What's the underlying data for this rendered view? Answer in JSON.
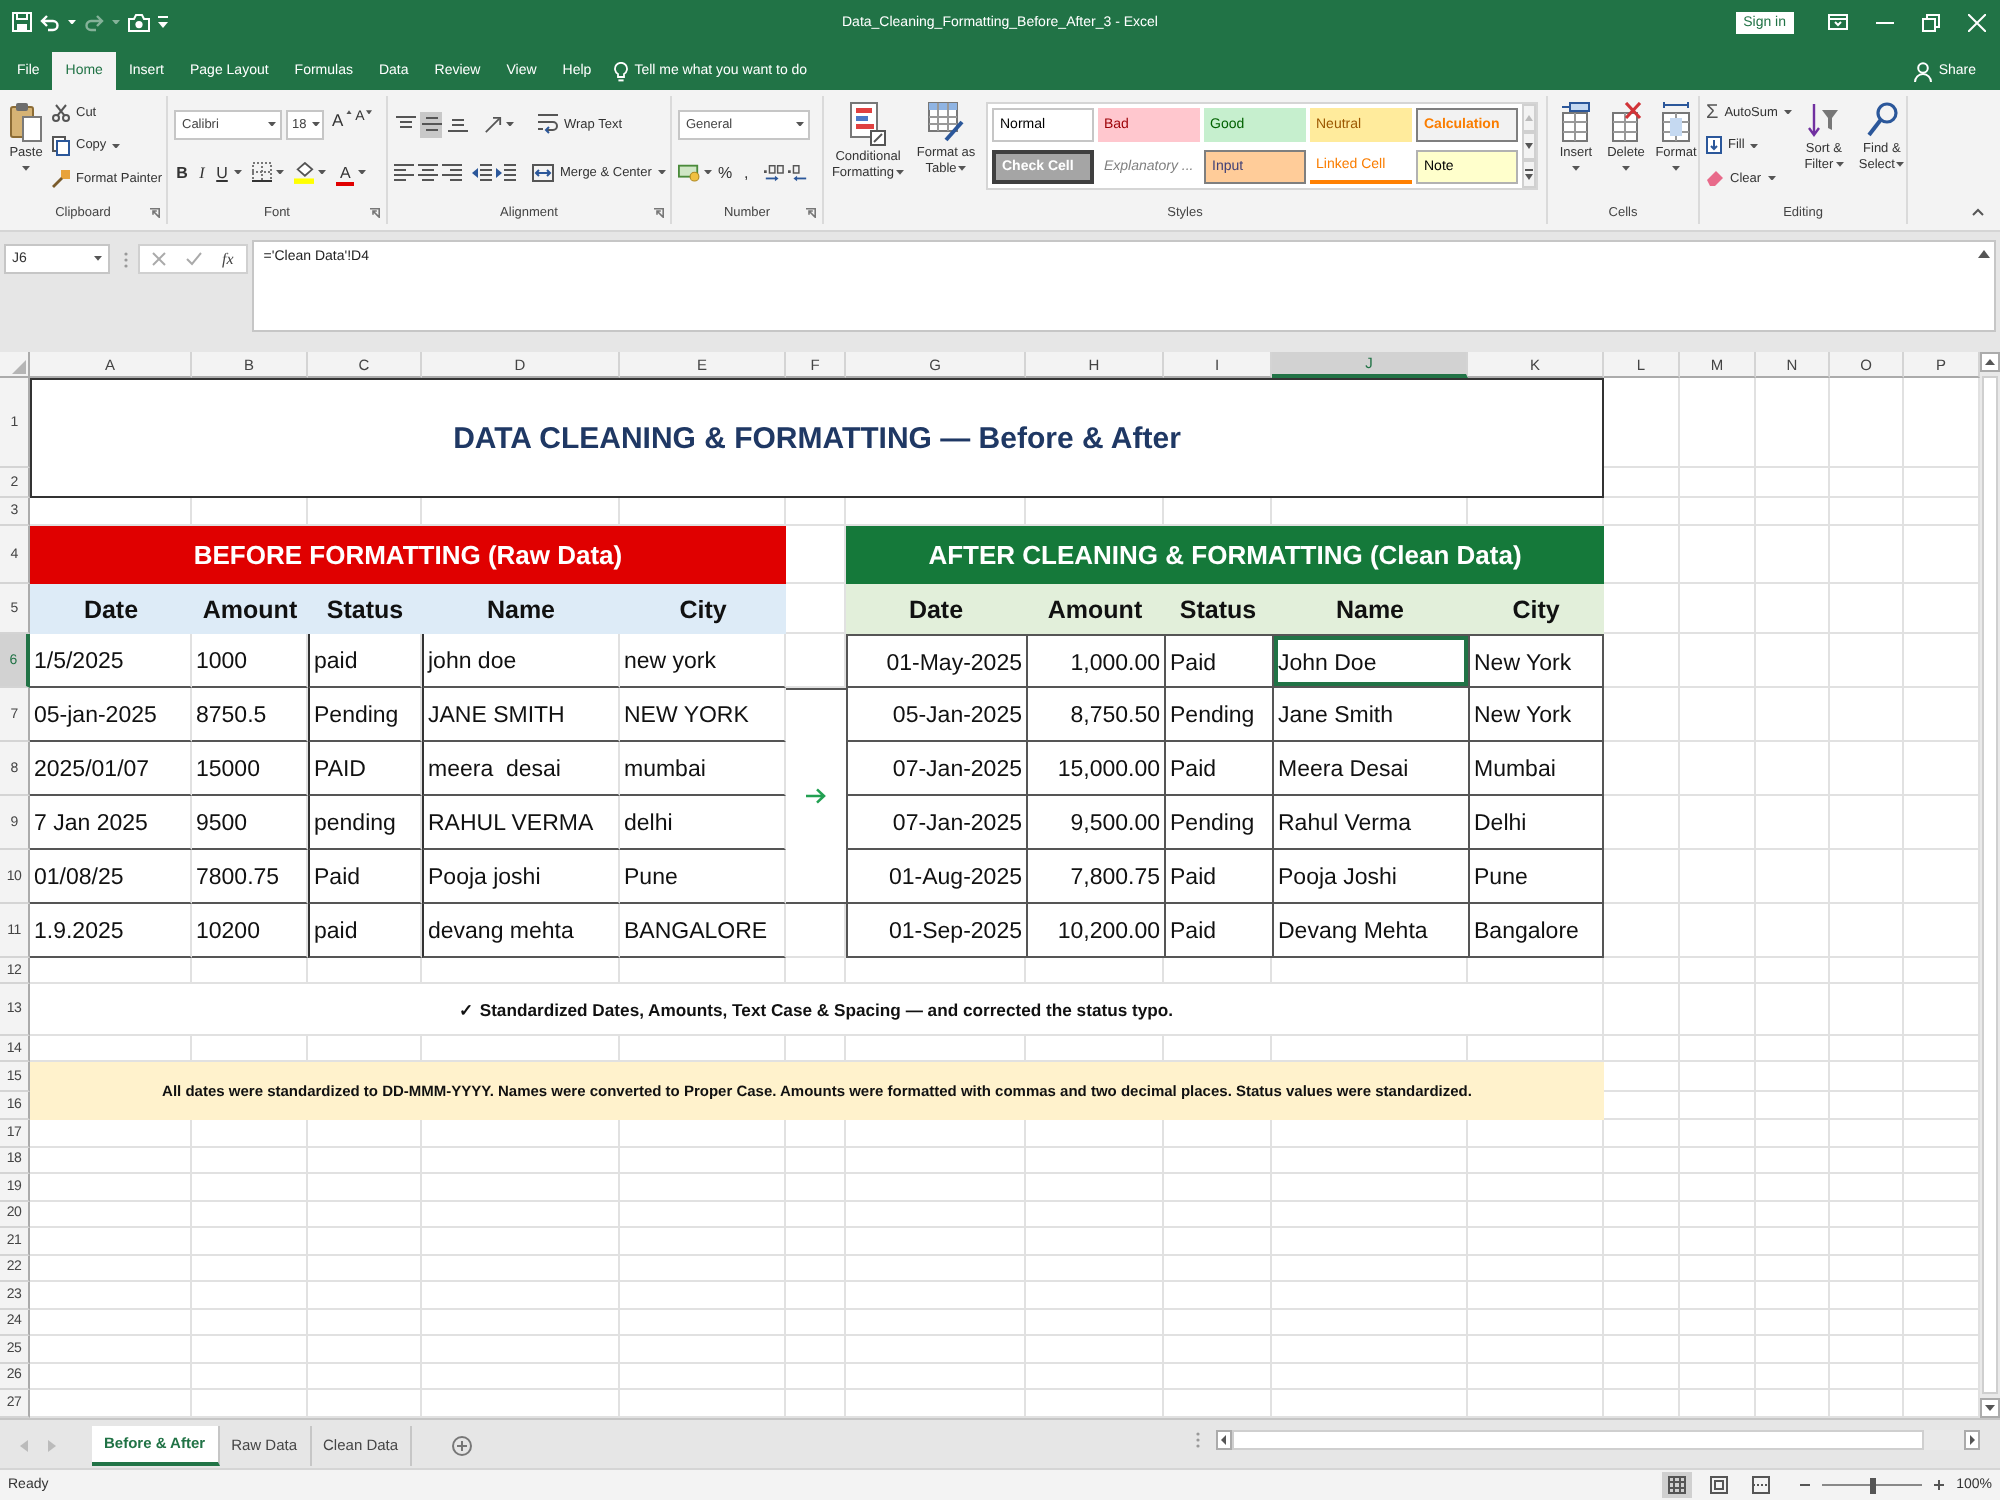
{
  "window": {
    "title": "Data_Cleaning_Formatting_Before_After_3 - Excel",
    "sign_in": "Sign in",
    "redo_disabled": true
  },
  "ribbon_tabs": [
    {
      "label": "File",
      "selected": false
    },
    {
      "label": "Home",
      "selected": true
    },
    {
      "label": "Insert",
      "selected": false
    },
    {
      "label": "Page Layout",
      "selected": false
    },
    {
      "label": "Formulas",
      "selected": false
    },
    {
      "label": "Data",
      "selected": false
    },
    {
      "label": "Review",
      "selected": false
    },
    {
      "label": "View",
      "selected": false
    },
    {
      "label": "Help",
      "selected": false
    }
  ],
  "tell_me": "Tell me what you want to do",
  "share": "Share",
  "ribbon": {
    "clipboard": {
      "label": "Clipboard",
      "paste": "Paste",
      "cut": "Cut",
      "copy": "Copy",
      "format_painter": "Format Painter"
    },
    "font": {
      "label": "Font",
      "name": "Calibri",
      "size": "18",
      "grow": "A",
      "shrink": "A",
      "bold": "B",
      "italic": "I",
      "underline": "U",
      "font_color": "A"
    },
    "alignment": {
      "label": "Alignment",
      "vertical": [
        {
          "selected": false
        },
        {
          "selected": true
        },
        {
          "selected": false
        }
      ],
      "wrap_text": "Wrap Text",
      "merge": "Merge & Center"
    },
    "number": {
      "label": "Number",
      "format": "General",
      "percent": "%",
      "comma": ","
    },
    "styles": {
      "label": "Styles",
      "conditional_formatting": "Conditional Formatting",
      "format_as_table": "Format as Table",
      "gallery": [
        {
          "label": "Normal",
          "kind": "normal"
        },
        {
          "label": "Bad",
          "kind": "bad"
        },
        {
          "label": "Good",
          "kind": "good"
        },
        {
          "label": "Neutral",
          "kind": "neutral"
        },
        {
          "label": "Calculation",
          "kind": "calculation"
        },
        {
          "label": "Check Cell",
          "kind": "check"
        },
        {
          "label": "Explanatory ...",
          "kind": "explanatory"
        },
        {
          "label": "Input",
          "kind": "input"
        },
        {
          "label": "Linked Cell",
          "kind": "linked"
        },
        {
          "label": "Note",
          "kind": "note"
        }
      ]
    },
    "cells": {
      "label": "Cells",
      "insert": "Insert",
      "delete": "Delete",
      "format": "Format"
    },
    "editing": {
      "label": "Editing",
      "autosum_symbol": "Σ",
      "autosum": "AutoSum",
      "fill": "Fill",
      "clear": "Clear",
      "sort_filter": "Sort & Filter",
      "find_select": "Find & Select"
    }
  },
  "formula_bar": {
    "name_box": "J6",
    "function": "fx",
    "formula": "='Clean Data'!D4"
  },
  "sheet": {
    "columns": [
      {
        "label": "A",
        "selected": false
      },
      {
        "label": "B",
        "selected": false
      },
      {
        "label": "C",
        "selected": false
      },
      {
        "label": "D",
        "selected": false
      },
      {
        "label": "E",
        "selected": false
      },
      {
        "label": "F",
        "selected": false
      },
      {
        "label": "G",
        "selected": false
      },
      {
        "label": "H",
        "selected": false
      },
      {
        "label": "I",
        "selected": false
      },
      {
        "label": "J",
        "selected": true
      },
      {
        "label": "K",
        "selected": false
      },
      {
        "label": "L",
        "selected": false
      },
      {
        "label": "M",
        "selected": false
      },
      {
        "label": "N",
        "selected": false
      },
      {
        "label": "O",
        "selected": false
      },
      {
        "label": "P",
        "selected": false
      }
    ],
    "rows": [
      {
        "label": "1",
        "selected": false
      },
      {
        "label": "2",
        "selected": false
      },
      {
        "label": "3",
        "selected": false
      },
      {
        "label": "4",
        "selected": false
      },
      {
        "label": "5",
        "selected": false
      },
      {
        "label": "6",
        "selected": true
      },
      {
        "label": "7",
        "selected": false
      },
      {
        "label": "8",
        "selected": false
      },
      {
        "label": "9",
        "selected": false
      },
      {
        "label": "10",
        "selected": false
      },
      {
        "label": "11",
        "selected": false
      },
      {
        "label": "12",
        "selected": false
      },
      {
        "label": "13",
        "selected": false
      },
      {
        "label": "14",
        "selected": false
      },
      {
        "label": "15",
        "selected": false
      },
      {
        "label": "16",
        "selected": false
      },
      {
        "label": "17",
        "selected": false
      },
      {
        "label": "18",
        "selected": false
      },
      {
        "label": "19",
        "selected": false
      },
      {
        "label": "20",
        "selected": false
      },
      {
        "label": "21",
        "selected": false
      },
      {
        "label": "22",
        "selected": false
      },
      {
        "label": "23",
        "selected": false
      },
      {
        "label": "24",
        "selected": false
      },
      {
        "label": "25",
        "selected": false
      },
      {
        "label": "26",
        "selected": false
      },
      {
        "label": "27",
        "selected": false
      }
    ],
    "title": "DATA CLEANING & FORMATTING — Before & After",
    "tables": [
      {
        "kind": "before",
        "heading": "BEFORE FORMATTING (Raw Data)",
        "columns": [
          {
            "label": "Date",
            "kind": "text"
          },
          {
            "label": "Amount",
            "kind": "text"
          },
          {
            "label": "Status",
            "kind": "text"
          },
          {
            "label": "Name",
            "kind": "text"
          },
          {
            "label": "City",
            "kind": "text"
          }
        ],
        "rows": [
          [
            "1/5/2025",
            "1000",
            "paid",
            "john doe",
            "new york"
          ],
          [
            "05-jan-2025",
            "8750.5",
            "Pending",
            "JANE SMITH",
            "NEW YORK"
          ],
          [
            "2025/01/07",
            "15000",
            "PAID",
            "meera  desai",
            "mumbai"
          ],
          [
            "7 Jan 2025",
            "9500",
            "pending",
            "RAHUL VERMA",
            "delhi"
          ],
          [
            "01/08/25",
            "7800.75",
            "Paid",
            "Pooja joshi",
            "Pune"
          ],
          [
            "1.9.2025",
            "10200",
            "paid",
            "devang mehta",
            "BANGALORE"
          ]
        ]
      },
      {
        "kind": "after",
        "heading": "AFTER CLEANING & FORMATTING (Clean Data)",
        "columns": [
          {
            "label": "Date",
            "kind": "date"
          },
          {
            "label": "Amount",
            "kind": "number"
          },
          {
            "label": "Status",
            "kind": "text"
          },
          {
            "label": "Name",
            "kind": "text"
          },
          {
            "label": "City",
            "kind": "text"
          }
        ],
        "rows": [
          [
            "01-May-2025",
            "1,000.00",
            "Paid",
            "John Doe",
            "New York"
          ],
          [
            "05-Jan-2025",
            "8,750.50",
            "Pending",
            "Jane Smith",
            "New York"
          ],
          [
            "07-Jan-2025",
            "15,000.00",
            "Paid",
            "Meera Desai",
            "Mumbai"
          ],
          [
            "07-Jan-2025",
            "9,500.00",
            "Pending",
            "Rahul Verma",
            "Delhi"
          ],
          [
            "01-Aug-2025",
            "7,800.75",
            "Paid",
            "Pooja Joshi",
            "Pune"
          ],
          [
            "01-Sep-2025",
            "10,200.00",
            "Paid",
            "Devang Mehta",
            "Bangalore"
          ]
        ]
      }
    ],
    "summary": "✓ Standardized Dates, Amounts, Text Case & Spacing — and corrected the status typo.",
    "note": "All dates were standardized to DD-MMM-YYYY. Names were converted to Proper Case. Amounts were formatted with commas and two decimal places. Status values were standardized."
  },
  "sheet_tabs": [
    {
      "label": "Before & After",
      "selected": true
    },
    {
      "label": "Raw Data",
      "selected": false
    },
    {
      "label": "Clean Data",
      "selected": false
    }
  ],
  "status_bar": {
    "status": "Ready",
    "views": [
      {
        "selected": true
      },
      {
        "selected": false
      },
      {
        "selected": false
      }
    ],
    "zoom_slider": {
      "level": 0.5
    },
    "zoom": "100%"
  }
}
